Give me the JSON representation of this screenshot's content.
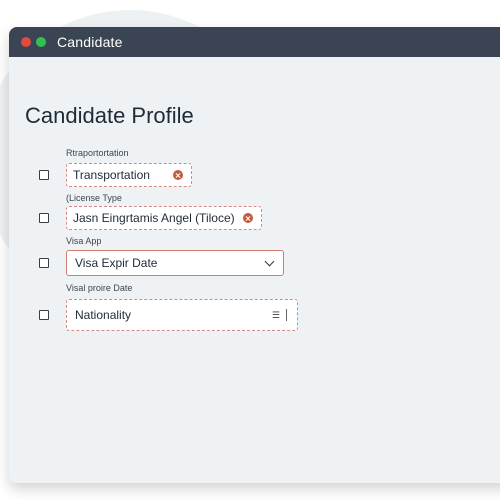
{
  "window": {
    "title": "Candidate"
  },
  "page": {
    "title": "Candidate Profile"
  },
  "fields": [
    {
      "label": "Rtraportortation",
      "value": "Transportation",
      "icon": "clear-icon"
    },
    {
      "label": "(License Type",
      "value": "Jasn Eingrtamis Angel (Tiloce)",
      "icon": "clear-icon"
    },
    {
      "label": "Visa App",
      "value": "Visa Expir Date",
      "icon": "chevron-down-icon"
    },
    {
      "label": "Visal proire Date",
      "value": "Nationality",
      "icon": "menu-icon"
    }
  ],
  "colors": {
    "titlebar": "#3a4452",
    "window_bg": "#eff2f4",
    "field_border": "#d08a84",
    "clear_icon": "#c25b3e"
  }
}
